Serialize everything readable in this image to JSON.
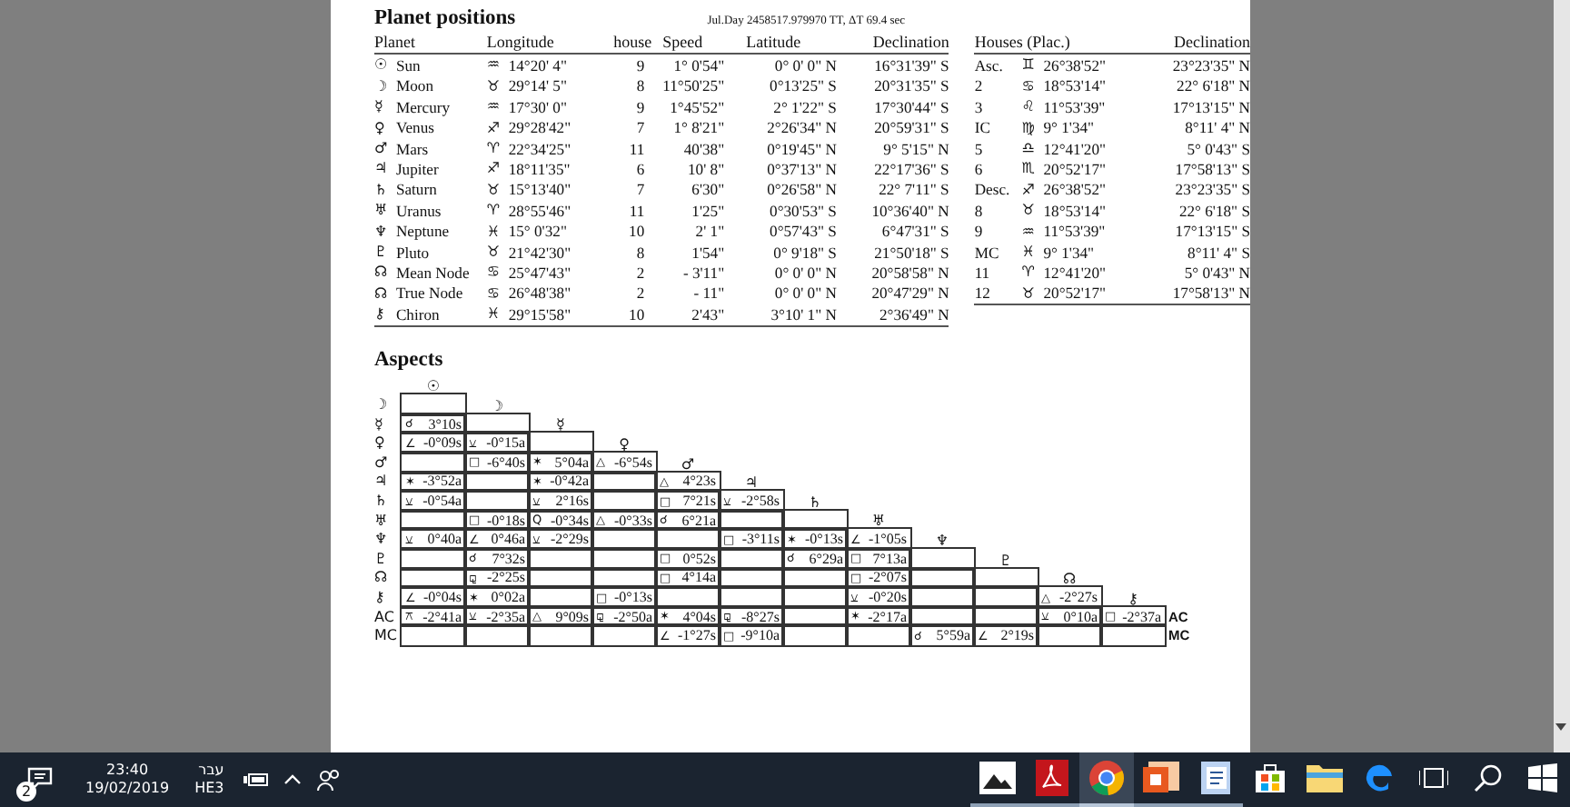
{
  "planet_positions": {
    "title": "Planet positions",
    "julian_day": "Jul.Day  2458517.979970 TT,  ΔT  69.4 sec",
    "columns": [
      "Planet",
      "Longitude",
      "house",
      "Speed",
      "Latitude",
      "Declination"
    ],
    "rows": [
      {
        "glyph": "☉",
        "name": "Sun",
        "sign": "♒",
        "longitude": "14°20' 4\"",
        "house": "9",
        "speed": "1° 0'54\"",
        "latitude": "0° 0' 0\" N",
        "declination": "16°31'39\" S"
      },
      {
        "glyph": "☽",
        "name": "Moon",
        "sign": "♉",
        "longitude": "29°14' 5\"",
        "house": "8",
        "speed": "11°50'25\"",
        "latitude": "0°13'25\" S",
        "declination": "20°31'35\" S"
      },
      {
        "glyph": "☿",
        "name": "Mercury",
        "sign": "♒",
        "longitude": "17°30' 0\"",
        "house": "9",
        "speed": "1°45'52\"",
        "latitude": "2° 1'22\" S",
        "declination": "17°30'44\" S"
      },
      {
        "glyph": "♀",
        "name": "Venus",
        "sign": "♐",
        "longitude": "29°28'42\"",
        "house": "7",
        "speed": "1° 8'21\"",
        "latitude": "2°26'34\" N",
        "declination": "20°59'31\" S"
      },
      {
        "glyph": "♂",
        "name": "Mars",
        "sign": "♈",
        "longitude": "22°34'25\"",
        "house": "11",
        "speed": "40'38\"",
        "latitude": "0°19'45\" N",
        "declination": "9° 5'15\" N"
      },
      {
        "glyph": "♃",
        "name": "Jupiter",
        "sign": "♐",
        "longitude": "18°11'35\"",
        "house": "6",
        "speed": "10' 8\"",
        "latitude": "0°37'13\" N",
        "declination": "22°17'36\" S"
      },
      {
        "glyph": "♄",
        "name": "Saturn",
        "sign": "♉",
        "longitude": "15°13'40\"",
        "house": "7",
        "speed": "6'30\"",
        "latitude": "0°26'58\" N",
        "declination": "22° 7'11\" S"
      },
      {
        "glyph": "♅",
        "name": "Uranus",
        "sign": "♈",
        "longitude": "28°55'46\"",
        "house": "11",
        "speed": "1'25\"",
        "latitude": "0°30'53\" S",
        "declination": "10°36'40\" N"
      },
      {
        "glyph": "♆",
        "name": "Neptune",
        "sign": "♓",
        "longitude": "15° 0'32\"",
        "house": "10",
        "speed": "2' 1\"",
        "latitude": "0°57'43\" S",
        "declination": "6°47'31\" S"
      },
      {
        "glyph": "♇",
        "name": "Pluto",
        "sign": "♉",
        "longitude": "21°42'30\"",
        "house": "8",
        "speed": "1'54\"",
        "latitude": "0° 9'18\" S",
        "declination": "21°50'18\" S"
      },
      {
        "glyph": "☊",
        "name": "Mean Node",
        "sign": "♋",
        "longitude": "25°47'43\"",
        "house": "2",
        "speed": "- 3'11\"",
        "latitude": "0° 0' 0\" N",
        "declination": "20°58'58\" N"
      },
      {
        "glyph": "☊",
        "name": "True Node",
        "sign": "♋",
        "longitude": "26°48'38\"",
        "house": "2",
        "speed": "- 11\"",
        "latitude": "0° 0' 0\" N",
        "declination": "20°47'29\" N"
      },
      {
        "glyph": "⚷",
        "name": "Chiron",
        "sign": "♓",
        "longitude": "29°15'58\"",
        "house": "10",
        "speed": "2'43\"",
        "latitude": "3°10' 1\" N",
        "declination": "2°36'49\" N"
      }
    ]
  },
  "houses": {
    "columns": [
      "Houses (Plac.)",
      "Declination"
    ],
    "rows": [
      {
        "label": "Asc.",
        "sign": "♊",
        "position": "26°38'52\"",
        "declination": "23°23'35\" N"
      },
      {
        "label": "2",
        "sign": "♋",
        "position": "18°53'14\"",
        "declination": "22° 6'18\" N"
      },
      {
        "label": "3",
        "sign": "♌",
        "position": "11°53'39\"",
        "declination": "17°13'15\" N"
      },
      {
        "label": "IC",
        "sign": "♍",
        "position": "9° 1'34\"",
        "declination": "8°11' 4\" N"
      },
      {
        "label": "5",
        "sign": "♎",
        "position": "12°41'20\"",
        "declination": "5° 0'43\" S"
      },
      {
        "label": "6",
        "sign": "♏",
        "position": "20°52'17\"",
        "declination": "17°58'13\" S"
      },
      {
        "label": "Desc.",
        "sign": "♐",
        "position": "26°38'52\"",
        "declination": "23°23'35\" S"
      },
      {
        "label": "8",
        "sign": "♉",
        "position": "18°53'14\"",
        "declination": "22° 6'18\" S"
      },
      {
        "label": "9",
        "sign": "♒",
        "position": "11°53'39\"",
        "declination": "17°13'15\" S"
      },
      {
        "label": "MC",
        "sign": "♓",
        "position": "9° 1'34\"",
        "declination": "8°11' 4\" S"
      },
      {
        "label": "11",
        "sign": "♈",
        "position": "12°41'20\"",
        "declination": "5° 0'43\" N"
      },
      {
        "label": "12",
        "sign": "♉",
        "position": "20°52'17\"",
        "declination": "17°58'13\" N"
      }
    ]
  },
  "aspects": {
    "title": "Aspects",
    "column_headers": [
      "☉",
      "☽",
      "☿",
      "♀",
      "♂",
      "♃",
      "♄",
      "♅",
      "♆",
      "♇",
      "☊",
      "⚷"
    ],
    "rows": [
      {
        "label": "☽",
        "cells": [
          null
        ]
      },
      {
        "label": "☿",
        "cells": [
          {
            "aspect": "☌",
            "orb": "3°10s"
          },
          null
        ]
      },
      {
        "label": "♀",
        "cells": [
          {
            "aspect": "∠",
            "orb": "-0°09s"
          },
          {
            "aspect": "⚺",
            "orb": "-0°15a"
          },
          null
        ]
      },
      {
        "label": "♂",
        "cells": [
          null,
          {
            "aspect": "□",
            "orb": "-6°40s"
          },
          {
            "aspect": "✶",
            "orb": "5°04a"
          },
          {
            "aspect": "△",
            "orb": "-6°54s"
          }
        ]
      },
      {
        "label": "♃",
        "cells": [
          {
            "aspect": "✶",
            "orb": "-3°52a"
          },
          null,
          {
            "aspect": "✶",
            "orb": "-0°42a"
          },
          null,
          {
            "aspect": "△",
            "orb": "4°23s"
          }
        ]
      },
      {
        "label": "♄",
        "cells": [
          {
            "aspect": "⚺",
            "orb": "-0°54a"
          },
          null,
          {
            "aspect": "⚺",
            "orb": "2°16s"
          },
          null,
          {
            "aspect": "□",
            "orb": "7°21s"
          },
          {
            "aspect": "⚺",
            "orb": "-2°58s"
          }
        ]
      },
      {
        "label": "♅",
        "cells": [
          null,
          {
            "aspect": "□",
            "orb": "-0°18s"
          },
          {
            "aspect": "Q",
            "orb": "-0°34s"
          },
          {
            "aspect": "△",
            "orb": "-0°33s"
          },
          {
            "aspect": "☌",
            "orb": "6°21a"
          },
          null,
          null
        ]
      },
      {
        "label": "♆",
        "cells": [
          {
            "aspect": "⚺",
            "orb": "0°40a"
          },
          {
            "aspect": "∠",
            "orb": "0°46a"
          },
          {
            "aspect": "⚺",
            "orb": "-2°29s"
          },
          null,
          null,
          {
            "aspect": "□",
            "orb": "-3°11s"
          },
          {
            "aspect": "✶",
            "orb": "-0°13s"
          },
          {
            "aspect": "∠",
            "orb": "-1°05s"
          }
        ]
      },
      {
        "label": "♇",
        "cells": [
          null,
          {
            "aspect": "☌",
            "orb": "7°32s"
          },
          null,
          null,
          {
            "aspect": "□",
            "orb": "0°52s"
          },
          null,
          {
            "aspect": "☌",
            "orb": "6°29a"
          },
          {
            "aspect": "□",
            "orb": "7°13a"
          },
          null
        ]
      },
      {
        "label": "☊",
        "cells": [
          null,
          {
            "aspect": "⚼",
            "orb": "-2°25s"
          },
          null,
          null,
          {
            "aspect": "□",
            "orb": "4°14a"
          },
          null,
          null,
          {
            "aspect": "□",
            "orb": "-2°07s"
          },
          null,
          null
        ]
      },
      {
        "label": "⚷",
        "cells": [
          {
            "aspect": "∠",
            "orb": "-0°04s"
          },
          {
            "aspect": "✶",
            "orb": "0°02a"
          },
          null,
          {
            "aspect": "□",
            "orb": "-0°13s"
          },
          null,
          null,
          null,
          {
            "aspect": "⚺",
            "orb": "-0°20s"
          },
          null,
          null,
          {
            "aspect": "△",
            "orb": "-2°27s"
          }
        ]
      },
      {
        "label": "AC",
        "end_label": "AC",
        "cells": [
          {
            "aspect": "⚻",
            "orb": "-2°41a"
          },
          {
            "aspect": "⚺",
            "orb": "-2°35a"
          },
          {
            "aspect": "△",
            "orb": "9°09s"
          },
          {
            "aspect": "⚼",
            "orb": "-2°50a"
          },
          {
            "aspect": "✶",
            "orb": "4°04s"
          },
          {
            "aspect": "⚼",
            "orb": "-8°27s"
          },
          null,
          {
            "aspect": "✶",
            "orb": "-2°17a"
          },
          null,
          null,
          {
            "aspect": "⚺",
            "orb": "0°10a"
          },
          {
            "aspect": "□",
            "orb": "-2°37a"
          }
        ]
      },
      {
        "label": "MC",
        "end_label": "MC",
        "cells": [
          null,
          null,
          null,
          null,
          {
            "aspect": "∠",
            "orb": "-1°27s"
          },
          {
            "aspect": "□",
            "orb": "-9°10a"
          },
          null,
          null,
          {
            "aspect": "☌",
            "orb": "5°59a"
          },
          {
            "aspect": "∠",
            "orb": "2°19s"
          },
          null,
          null
        ]
      }
    ]
  },
  "taskbar": {
    "notification_count": "2",
    "time": "23:40",
    "date": "19/02/2019",
    "language": "עבר",
    "keyboard": "HE3",
    "apps": [
      {
        "kind": "photos",
        "selected": false,
        "running": true
      },
      {
        "kind": "pdf",
        "selected": false,
        "running": true
      },
      {
        "kind": "browser",
        "selected": true,
        "running": true
      },
      {
        "kind": "slides",
        "selected": false,
        "running": true
      },
      {
        "kind": "document",
        "selected": false,
        "running": true
      },
      {
        "kind": "store",
        "selected": false,
        "running": false
      },
      {
        "kind": "folder",
        "selected": false,
        "running": false
      },
      {
        "kind": "edge",
        "selected": false,
        "running": false
      },
      {
        "kind": "taskview",
        "selected": false,
        "running": false
      },
      {
        "kind": "search",
        "selected": false,
        "running": false
      },
      {
        "kind": "start",
        "selected": false,
        "running": false
      }
    ]
  }
}
